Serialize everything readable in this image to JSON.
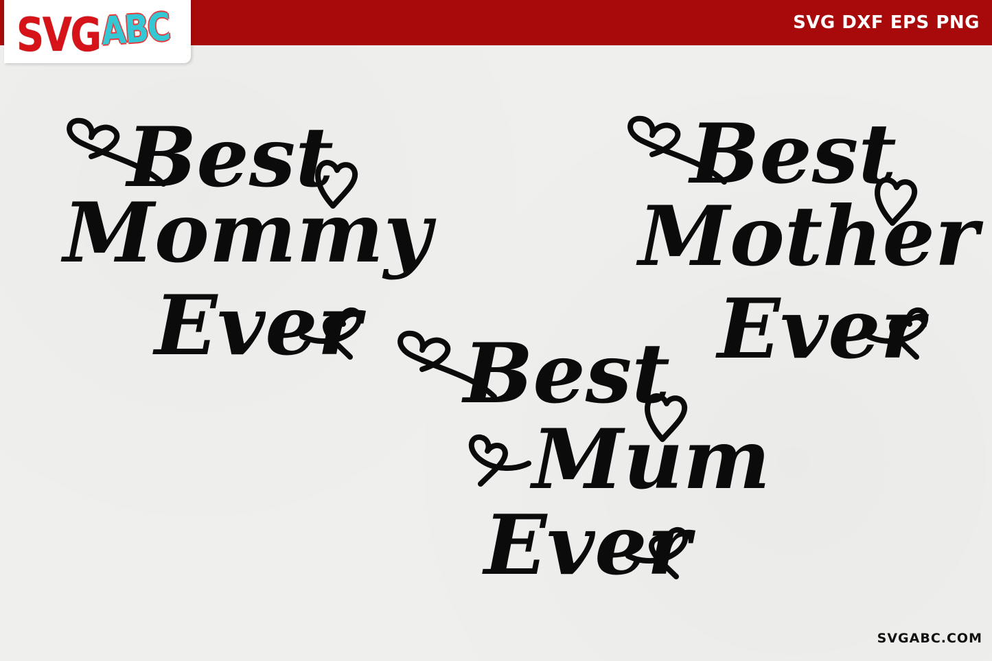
{
  "header": {
    "logo_svg": "SVG",
    "logo_abc": "ABC",
    "formats": "SVG DXF EPS PNG",
    "brand_color": "#a80a0b"
  },
  "footer": {
    "url": "SVGABC.COM"
  },
  "designs": [
    {
      "line1": "Best",
      "line2": "Mommy",
      "line3": "Ever"
    },
    {
      "line1": "Best",
      "line2": "Mother",
      "line3": "Ever"
    },
    {
      "line1": "Best",
      "line2": "Mum",
      "line3": "Ever"
    }
  ],
  "ink_color": "#0b0b0b"
}
